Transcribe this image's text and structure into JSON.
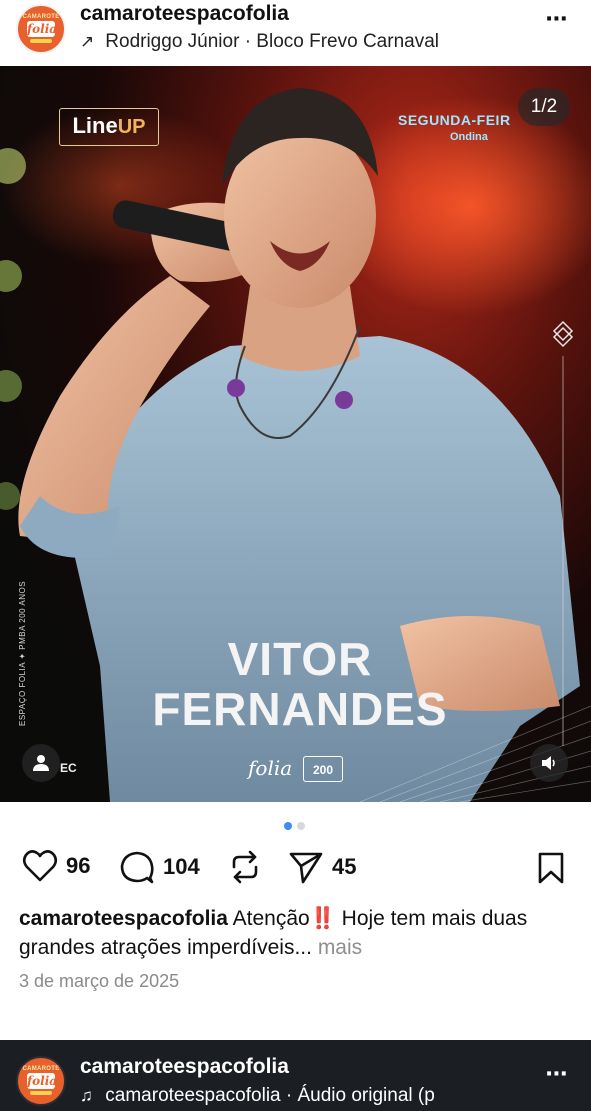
{
  "post": {
    "username": "camaroteespacofolia",
    "avatar_top": "CAMAROTE",
    "avatar_mid": "folia",
    "collab_arrow": "↗",
    "collab_line": "Rodriggo Júnior · Bloco Frevo Carnaval",
    "more_icon": "⋯"
  },
  "photo": {
    "lineup_main": "Line",
    "lineup_up": "UP",
    "day": "SEGUNDA-FEIR",
    "day_sub": "Ondina",
    "counter": "1/2",
    "side_text": "ESPAÇO FOLIA ✦ PMBA 200 ANOS",
    "artist_line1": "VITOR",
    "artist_line2": "FERNANDES",
    "ec_text": "EC",
    "folia_logo": "folia",
    "pmba_logo": "200"
  },
  "carousel": {
    "total": 2,
    "active": 1
  },
  "actions": {
    "likes": "96",
    "comments": "104",
    "shares": "45"
  },
  "caption": {
    "user": "camaroteespacofolia",
    "text_before": " Atenção",
    "bang": "‼️",
    "text_after": " Hoje tem mais duas grandes atrações imperdíveis... ",
    "more": "mais"
  },
  "date": "3 de março de 2025",
  "next_post": {
    "username": "camaroteespacofolia",
    "avatar_top": "CAMAROTE",
    "avatar_mid": "folia",
    "music_icon": "♫",
    "audio_line": "camaroteespacofolia · Áudio original (p",
    "more_icon": "⋯"
  },
  "colors": {
    "accent_dot": "#3f8cf5",
    "day_label": "#9fe6ff",
    "lineup_up": "#f3b35a",
    "avatar_bg": "#e8602b"
  }
}
